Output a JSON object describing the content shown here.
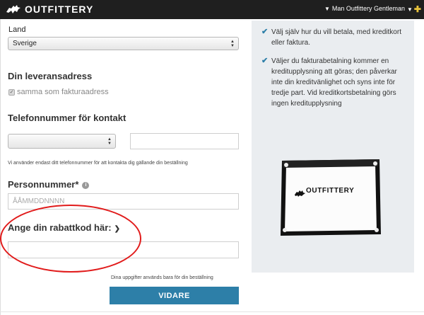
{
  "header": {
    "brand": "OUTFITTERY",
    "user_menu": "Man Outfittery Gentleman"
  },
  "form": {
    "country_label": "Land",
    "country_value": "Sverige",
    "delivery_heading": "Din leveransadress",
    "same_as_billing_label": "samma som fakturaadress",
    "phone_heading": "Telefonnummer för kontakt",
    "phone_country_value": "",
    "phone_value": "",
    "phone_note": "Vi använder endast ditt telefonnummer för att kontakta dig gällande din beställning",
    "personal_number_label": "Personnummer*",
    "personal_number_placeholder": "ÅÅMMDDNNNN",
    "discount_label": "Ange din rabattkod här:",
    "discount_value": "",
    "data_note": "Dina uppgifter används bara för din beställning",
    "submit_label": "VIDARE"
  },
  "sidebar": {
    "bullets": [
      "Välj själv hur du vill betala, med kreditkort eller faktura.",
      "Väljer du fakturabetalning kommer en kreditupplysning att göras; den påverkar inte din kreditvänlighet och syns inte för tredje part. Vid kreditkortsbetalning görs ingen kreditupplysning"
    ],
    "box_brand": "OUTFITTERY"
  },
  "colors": {
    "topbar": "#1f1f1f",
    "accent": "#2d7fa8",
    "annotation": "#e11b1b",
    "sidebar_bg": "#eaedf0"
  }
}
